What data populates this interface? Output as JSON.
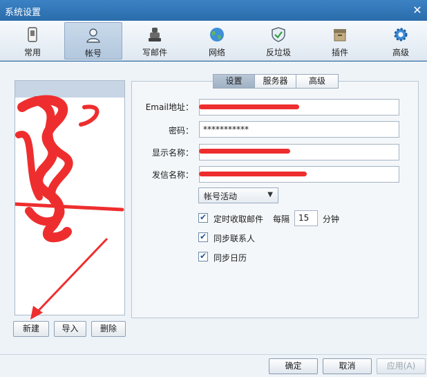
{
  "window": {
    "title": "系统设置",
    "close_glyph": "✕"
  },
  "toolbar": {
    "items": [
      {
        "label": "常用",
        "icon": "general-icon"
      },
      {
        "label": "帐号",
        "icon": "account-icon"
      },
      {
        "label": "写邮件",
        "icon": "compose-icon"
      },
      {
        "label": "网络",
        "icon": "network-icon"
      },
      {
        "label": "反垃圾",
        "icon": "antispam-icon"
      },
      {
        "label": "插件",
        "icon": "plugin-icon"
      },
      {
        "label": "高级",
        "icon": "advanced-icon"
      }
    ],
    "active": "帐号"
  },
  "account_list": {
    "buttons": {
      "new": "新建",
      "import": "导入",
      "delete": "删除"
    }
  },
  "settings": {
    "tabs": [
      {
        "label": "设置"
      },
      {
        "label": "服务器"
      },
      {
        "label": "高级"
      }
    ],
    "active_tab": "设置",
    "fields": {
      "email_label": "Email地址：",
      "password_label": "密码：",
      "password_value": "***********",
      "display_name_label": "显示名称：",
      "sender_name_label": "发信名称："
    },
    "account_status": {
      "value": "帐号活动"
    },
    "options": {
      "timed_receive": "定时收取邮件",
      "interval_prefix": "每隔",
      "interval_value": "15",
      "interval_unit": "分钟",
      "sync_contacts": "同步联系人",
      "sync_calendar": "同步日历"
    }
  },
  "footer": {
    "ok": "确定",
    "cancel": "取消",
    "apply": "应用(A)"
  },
  "colors": {
    "title_bar": "#2d6fab",
    "redaction": "#ee2e2e",
    "accent": "#245a9a"
  }
}
